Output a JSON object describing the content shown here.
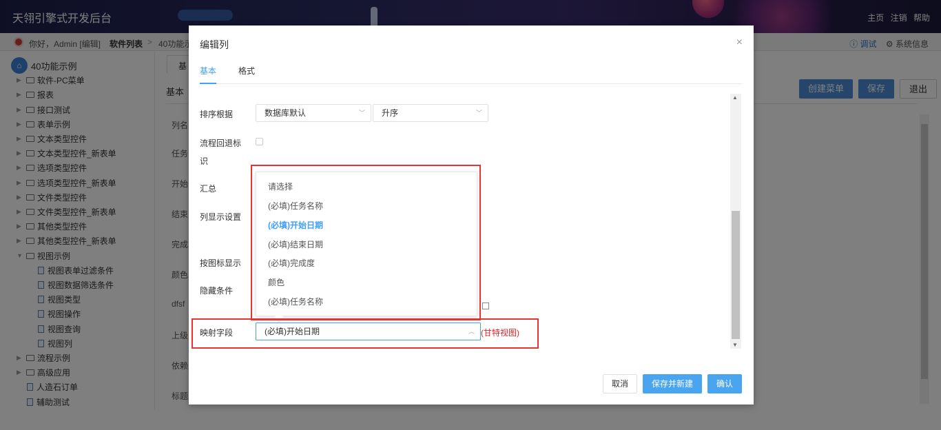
{
  "header": {
    "app_title": "天翎引擎式开发后台",
    "links": [
      "主页",
      "注销",
      "帮助"
    ]
  },
  "subbar": {
    "greeting": "你好，Admin [编辑]",
    "crumb_current": "软件列表",
    "crumb_sep": ">",
    "crumb_next": "40功能示",
    "debug": "ⓘ 调试",
    "sysinfo": "⚙ 系统信息"
  },
  "sidebar": {
    "root": "40功能示例",
    "items": [
      "软件-PC菜单",
      "报表",
      "接口测试",
      "表单示例",
      "文本类型控件",
      "文本类型控件_新表单",
      "选项类型控件",
      "选项类型控件_新表单",
      "文件类型控件",
      "文件类型控件_新表单",
      "其他类型控件",
      "其他类型控件_新表单",
      "视图示例"
    ],
    "children": [
      "视图表单过滤条件",
      "视图数据筛选条件",
      "视图类型",
      "视图操作",
      "视图查询",
      "视图列"
    ],
    "tail_items": [
      "流程示例",
      "高级应用"
    ],
    "pages": [
      "人造石订单",
      "辅助测试"
    ]
  },
  "main": {
    "tab_label": "基",
    "section_label": "基本",
    "buttons": {
      "create_menu": "创建菜单",
      "save": "保存",
      "exit": "退出"
    },
    "row_labels": [
      "列名",
      "任务",
      "开始",
      "结束",
      "完成",
      "颜色",
      "dfsf",
      "上级",
      "依赖",
      "标题"
    ]
  },
  "modal": {
    "title": "编辑列",
    "close": "×",
    "tabs": {
      "basic": "基本",
      "format": "格式"
    },
    "fields": {
      "sort_label": "排序根据",
      "sort_value": "数据库默认",
      "order_value": "升序",
      "flow_back_label_line1": "流程回退标",
      "flow_back_label_line2": "识",
      "summary_label": "汇总",
      "col_display_label": "列显示设置",
      "icon_display_label": "按图标显示",
      "hide_cond_label": "隐藏条件",
      "map_field_label": "映射字段",
      "map_field_value": "(必填)开始日期",
      "map_note": "(甘特视图)"
    },
    "dropdown_options": [
      {
        "label": "请选择",
        "selected": false
      },
      {
        "label": "(必填)任务名称",
        "selected": false
      },
      {
        "label": "(必填)开始日期",
        "selected": true
      },
      {
        "label": "(必填)结束日期",
        "selected": false
      },
      {
        "label": "(必填)完成度",
        "selected": false
      },
      {
        "label": "颜色",
        "selected": false
      },
      {
        "label": "(必填)任务名称",
        "selected": false
      }
    ],
    "footer": {
      "cancel": "取消",
      "save_new": "保存并新建",
      "confirm": "确认"
    }
  }
}
